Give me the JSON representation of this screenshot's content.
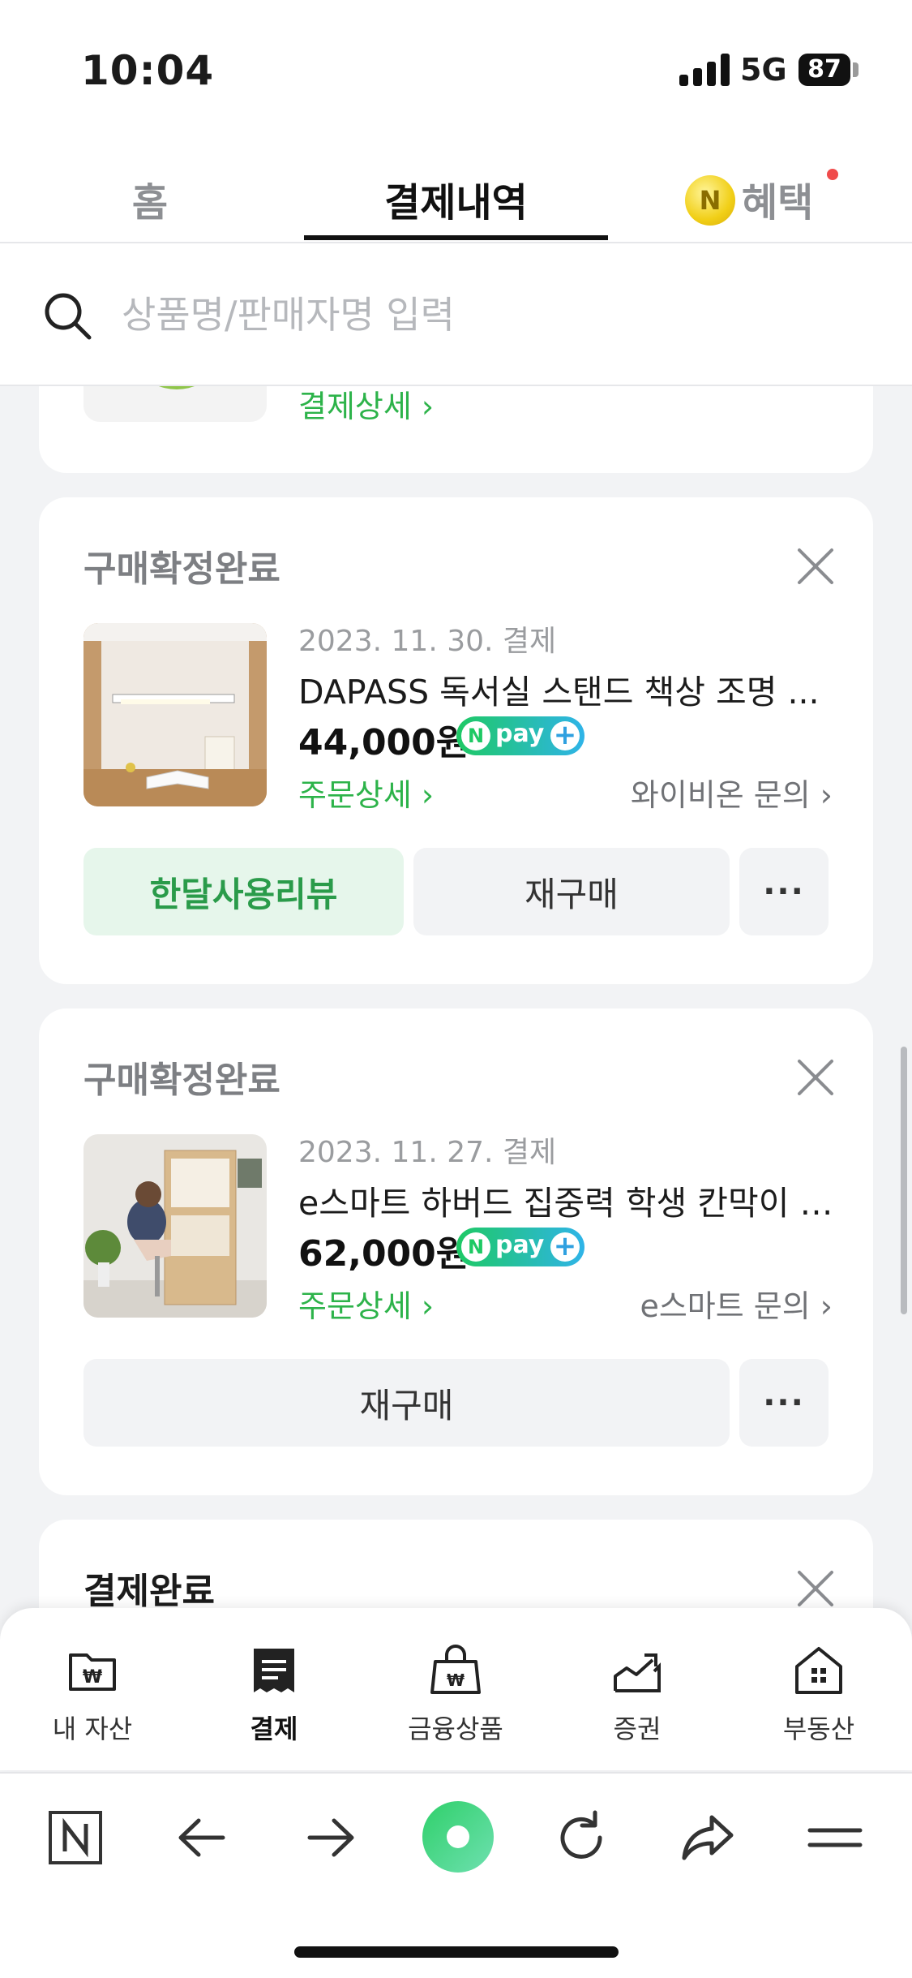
{
  "status_bar": {
    "time": "10:04",
    "network": "5G",
    "battery": "87"
  },
  "tabs": [
    {
      "label": "홈",
      "active": false
    },
    {
      "label": "결제내역",
      "active": true
    },
    {
      "label": "혜택",
      "active": false,
      "has_badge": true
    }
  ],
  "search": {
    "placeholder": "상품명/판매자명 입력",
    "value": ""
  },
  "prev_card": {
    "detail_link": "결제상세 ›"
  },
  "orders": [
    {
      "status": "구매확정완료",
      "date": "2023. 11. 30. 결제",
      "title": "DAPASS 독서실 스탠드 책상 조명 ...",
      "price": "44,000원",
      "pay_badge": "pay",
      "order_link": "주문상세 ›",
      "seller_link": "와이비온 문의 ›",
      "buttons": {
        "review": "한달사용리뷰",
        "rebuy": "재구매",
        "more": "···"
      }
    },
    {
      "status": "구매확정완료",
      "date": "2023. 11. 27. 결제",
      "title": "e스마트 하버드 집중력 학생 칸막이 1...",
      "price": "62,000원",
      "pay_badge": "pay",
      "order_link": "주문상세 ›",
      "seller_link": "e스마트 문의 ›",
      "buttons": {
        "rebuy": "재구매",
        "more": "···"
      }
    },
    {
      "status": "결제완료"
    }
  ],
  "app_nav": [
    {
      "label": "내 자산",
      "icon": "wallet-folder-icon",
      "active": false
    },
    {
      "label": "결제",
      "icon": "receipt-icon",
      "active": true
    },
    {
      "label": "금융상품",
      "icon": "money-bag-icon",
      "active": false
    },
    {
      "label": "증권",
      "icon": "stock-chart-icon",
      "active": false
    },
    {
      "label": "부동산",
      "icon": "house-icon",
      "active": false
    }
  ],
  "browser_bar": [
    "naver-n-icon",
    "back-arrow-icon",
    "forward-arrow-icon",
    "green-home-orb-icon",
    "refresh-icon",
    "share-icon",
    "menu-icon"
  ],
  "colors": {
    "accent_green": "#2db34a",
    "npay_gradient": [
      "#1ec964",
      "#2fb4e8"
    ],
    "badge_red": "#f04b4b"
  }
}
